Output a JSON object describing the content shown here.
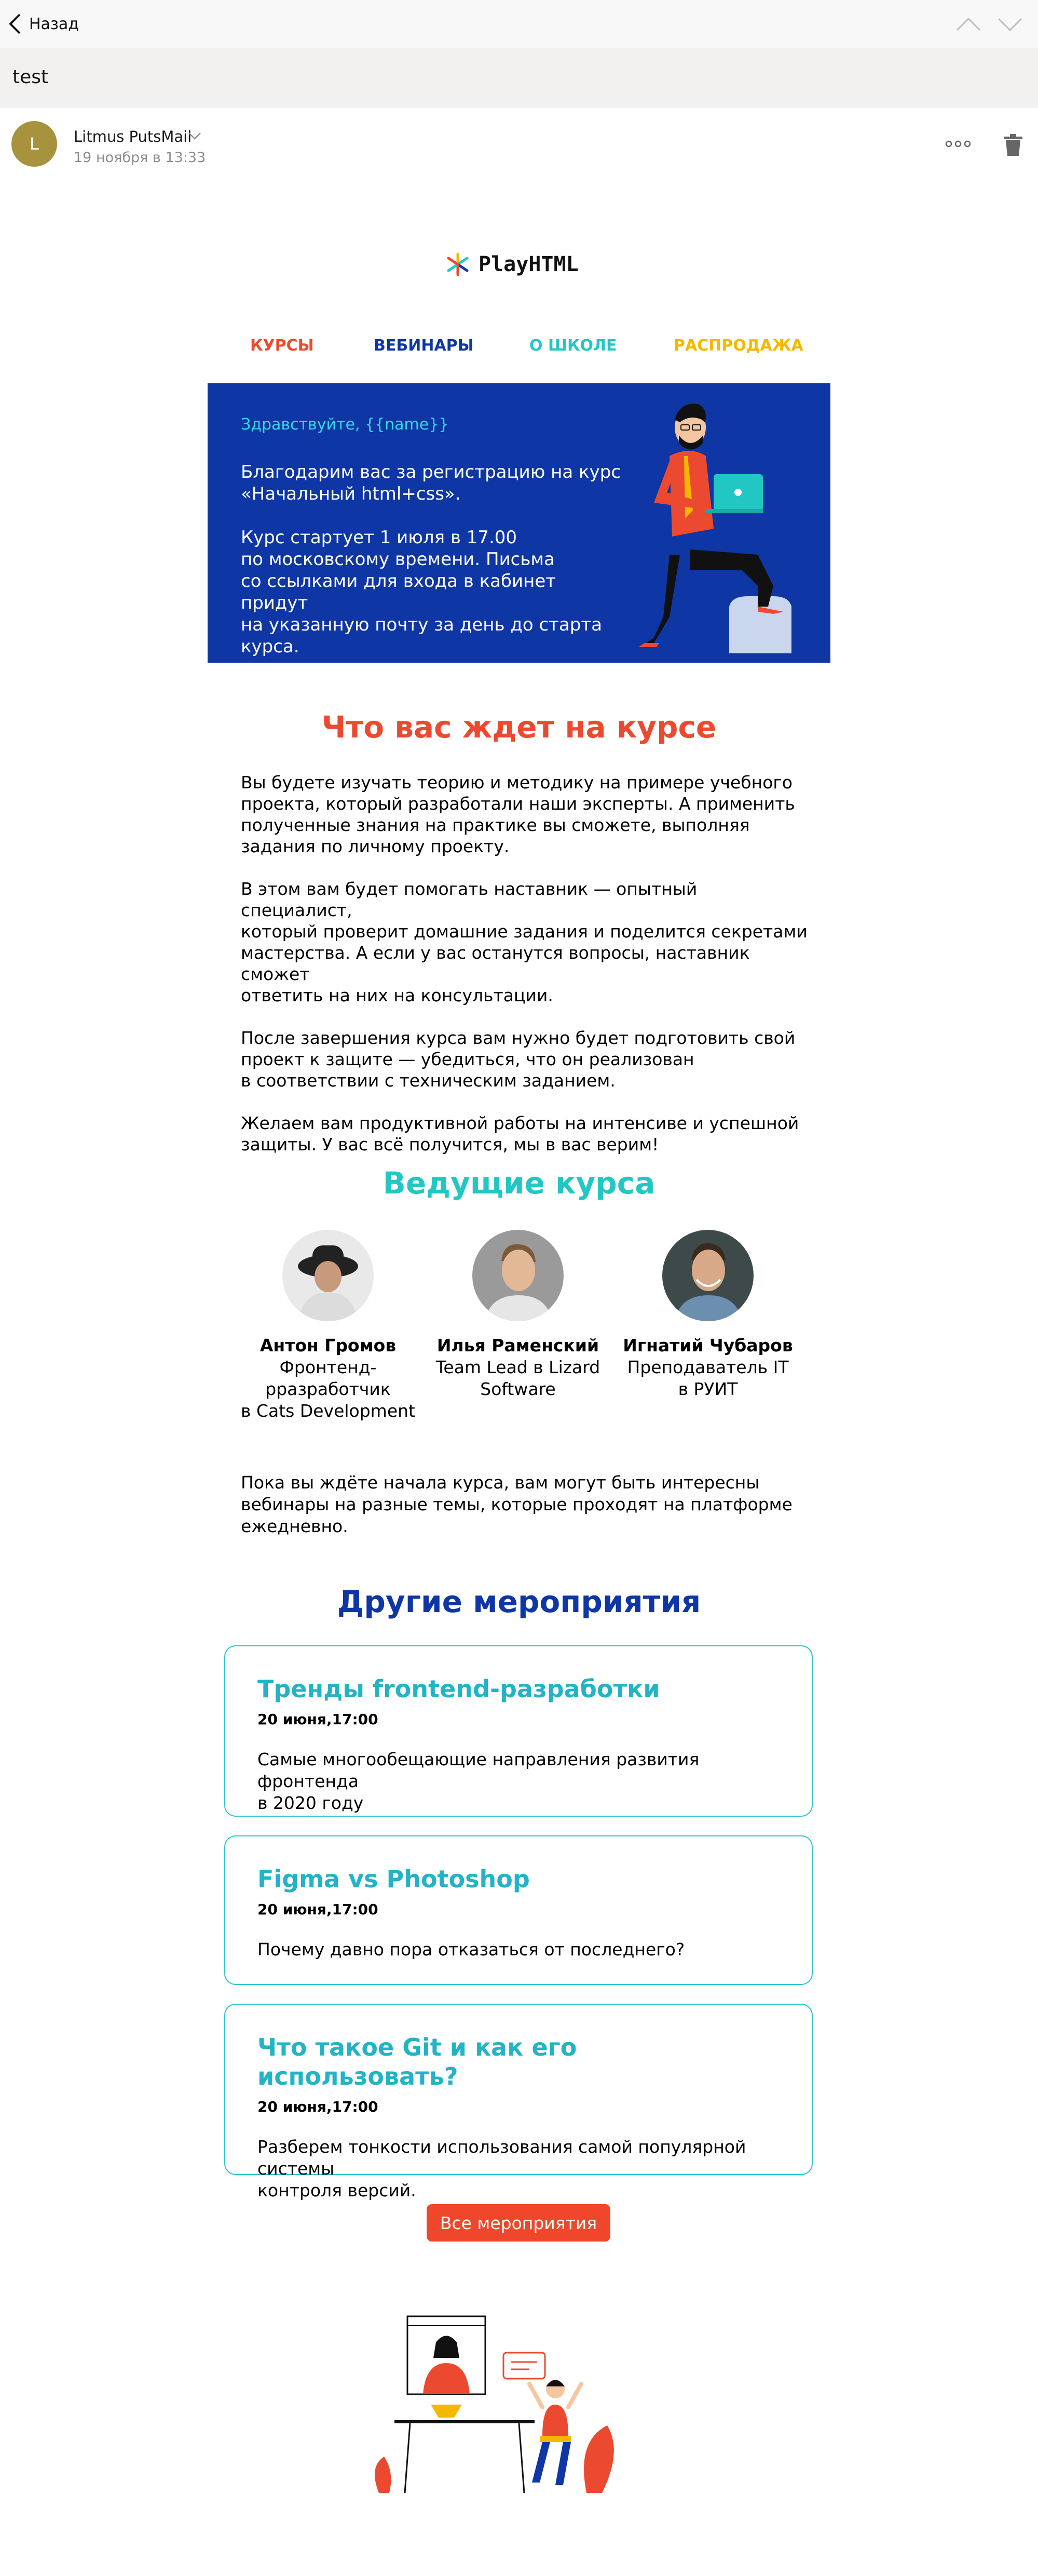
{
  "topbar": {
    "back_label": "Назад"
  },
  "subject": "test",
  "sender": {
    "initial": "L",
    "name": "Litmus PutsMail",
    "date": "19 ноября в 13:33"
  },
  "email": {
    "logo_text": "PlayHTML",
    "nav": [
      {
        "label": "КУРСЫ",
        "color": "#ec4a30"
      },
      {
        "label": "ВЕБИНАРЫ",
        "color": "#0e36a4"
      },
      {
        "label": "О ШКОЛЕ",
        "color": "#22c7c3"
      },
      {
        "label": "РАСПРОДАЖА",
        "color": "#f5b800"
      }
    ],
    "hero": {
      "greeting": "Здравствуйте, {{name}}",
      "paragraphs": [
        "Благодарим вас за регистрацию на курс\n«Начальный html+css».",
        "Курс стартует 1 июля в 17.00\nпо московскому времени. Письма\nсо ссылками для входа в кабинет придут\nна указанную почту за день до старта\nкурса."
      ]
    },
    "expect": {
      "title": "Что вас ждет на курсе",
      "paragraphs": [
        "Вы будете изучать теорию и методику на примере учебного\nпроекта, который разработали наши эксперты. А применить\nполученные знания на практике вы сможете, выполняя\nзадания по личному проекту.",
        "В этом вам будет помогать наставник — опытный специалист,\nкоторый проверит домашние задания и поделится секретами\nмастерства. А если у вас останутся вопросы, наставник сможет\nответить на них на консультации.",
        "После завершения курса вам нужно будет подготовить свой\nпроект к защите — убедиться, что он реализован\nв соответствии с техническим заданием.",
        "Желаем вам продуктивной работы на интенсиве и успешной\nзащиты. У вас всё получится, мы в вас верим!"
      ]
    },
    "teachers": {
      "title": "Ведущие курса",
      "items": [
        {
          "name": "Антон Громов",
          "role": "Фронтенд-\nрразработчик\nв Cats Development"
        },
        {
          "name": "Илья Раменский",
          "role": "Team Lead в Lizard\nSoftware"
        },
        {
          "name": "Игнатий Чубаров",
          "role": "Преподаватель IT\nв РУИТ"
        }
      ]
    },
    "upcoming_text": "Пока вы ждёте начала курса, вам могут быть интересны\nвебинары на разные темы, которые проходят на платформе\nежедневно.",
    "events": {
      "title": "Другие мероприятия",
      "items": [
        {
          "title": "Тренды frontend-разработки",
          "date": "20 июня,17:00",
          "desc": "Самые многообещающие направления развития фронтенда\nв 2020 году"
        },
        {
          "title": "Figma vs Photoshop",
          "date": "20 июня,17:00",
          "desc": "Почему давно пора отказаться от последнего?"
        },
        {
          "title": "Что такое Git и как его использовать?",
          "date": "20 июня,17:00",
          "desc": "Разберем тонкости использования самой популярной системы\nконтроля версий."
        }
      ],
      "all_button": "Все мероприятия"
    }
  }
}
